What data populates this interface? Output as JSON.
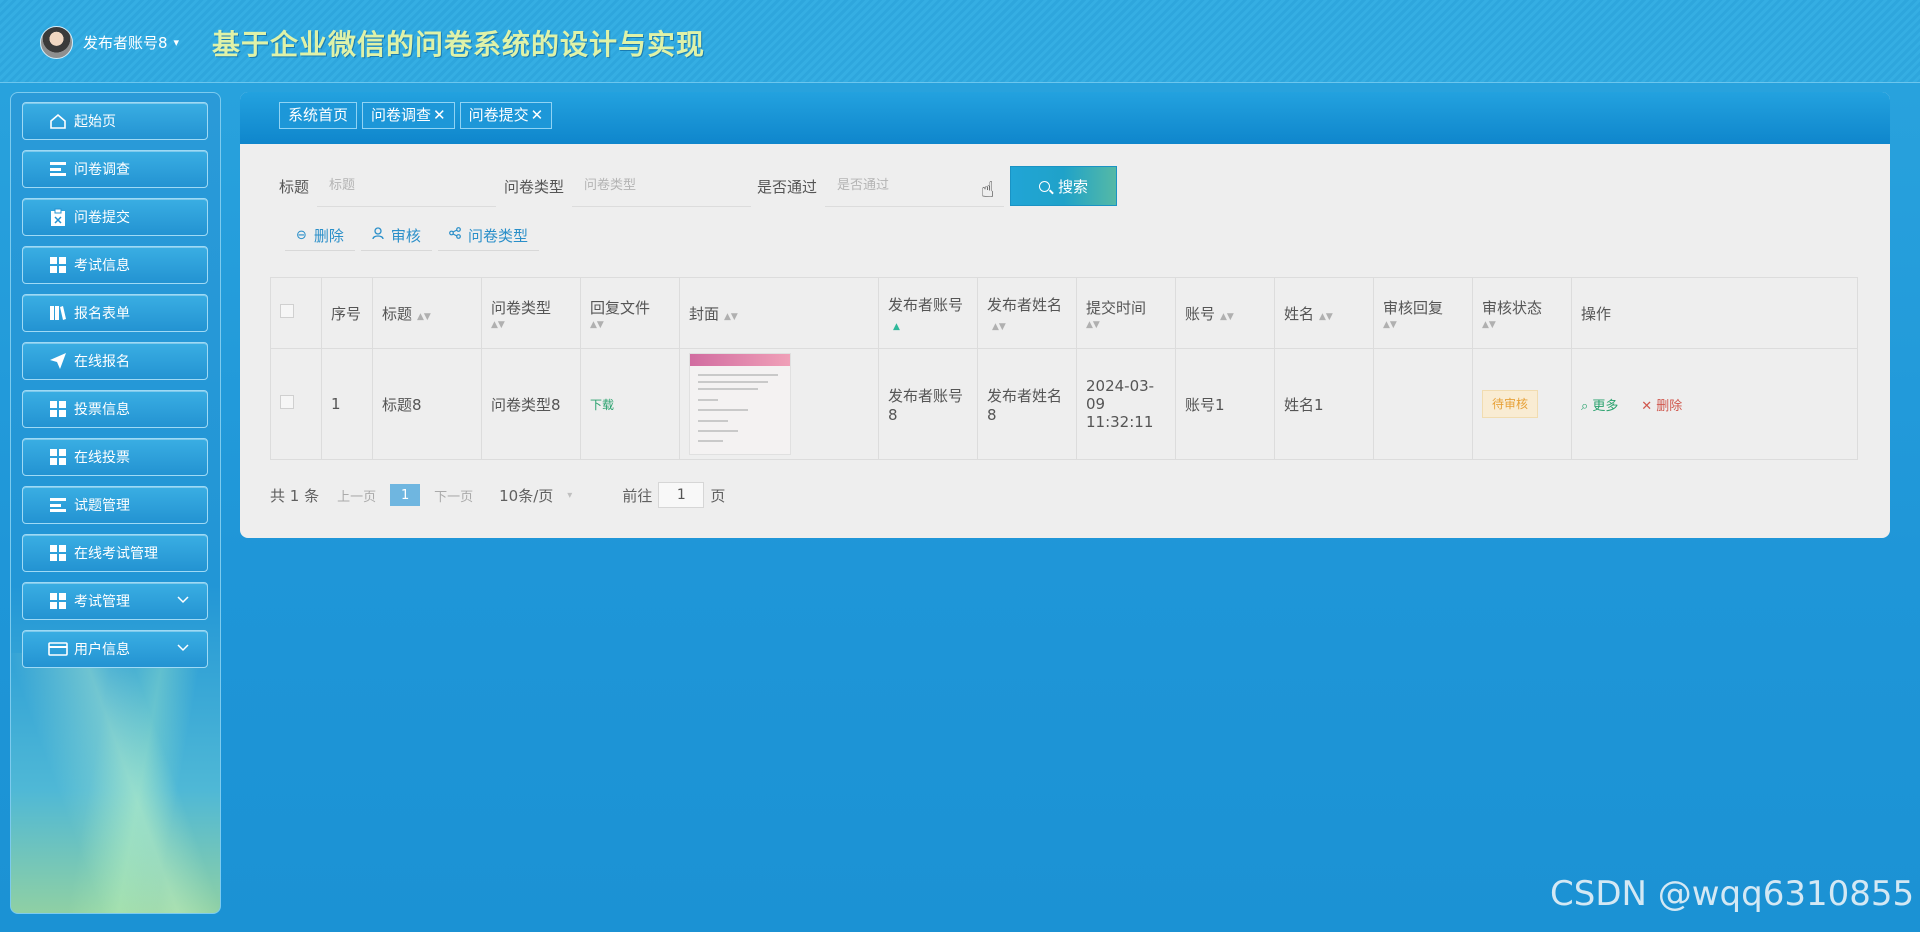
{
  "header": {
    "user_name": "发布者账号8",
    "caret": "▾",
    "app_title": "基于企业微信的问卷系统的设计与实现"
  },
  "sidebar": {
    "items": [
      {
        "label": "起始页",
        "icon": "home-icon"
      },
      {
        "label": "问卷调查",
        "icon": "list-icon"
      },
      {
        "label": "问卷提交",
        "icon": "clipboard-icon"
      },
      {
        "label": "考试信息",
        "icon": "grid-icon"
      },
      {
        "label": "报名表单",
        "icon": "book-icon"
      },
      {
        "label": "在线报名",
        "icon": "send-icon"
      },
      {
        "label": "投票信息",
        "icon": "grid-icon"
      },
      {
        "label": "在线投票",
        "icon": "grid-icon"
      },
      {
        "label": "试题管理",
        "icon": "list-icon"
      },
      {
        "label": "在线考试管理",
        "icon": "grid-icon"
      },
      {
        "label": "考试管理",
        "icon": "grid-icon"
      },
      {
        "label": "用户信息",
        "icon": "card-icon"
      }
    ]
  },
  "tabs": [
    {
      "label": "系统首页",
      "closable": false
    },
    {
      "label": "问卷调查",
      "closable": true
    },
    {
      "label": "问卷提交",
      "closable": true
    }
  ],
  "search": {
    "title_label": "标题",
    "title_placeholder": "标题",
    "type_label": "问卷类型",
    "type_placeholder": "问卷类型",
    "passed_label": "是否通过",
    "passed_placeholder": "是否通过",
    "button_label": "搜索"
  },
  "actions": {
    "delete": "删除",
    "audit": "审核",
    "type": "问卷类型"
  },
  "table": {
    "headers": {
      "index": "序号",
      "title": "标题",
      "type": "问卷类型",
      "reply_file": "回复文件",
      "cover": "封面",
      "publisher_account": "发布者账号",
      "publisher_name": "发布者姓名",
      "submit_time": "提交时间",
      "account": "账号",
      "name": "姓名",
      "audit_reply": "审核回复",
      "audit_status": "审核状态",
      "operation": "操作"
    },
    "rows": [
      {
        "index": "1",
        "title": "标题8",
        "type": "问卷类型8",
        "reply_file": "下载",
        "publisher_account": "发布者账号8",
        "publisher_name": "发布者姓名8",
        "submit_time": "2024-03-09 11:32:11",
        "account": "账号1",
        "name": "姓名1",
        "audit_reply": "",
        "audit_status": "待审核",
        "op_more": "更多",
        "op_delete": "删除"
      }
    ]
  },
  "pager": {
    "total": "共 1 条",
    "prev": "上一页",
    "current": "1",
    "next": "下一页",
    "page_size": "10条/页",
    "goto_prefix": "前往",
    "goto_value": "1",
    "goto_suffix": "页"
  },
  "watermark": "CSDN @wqq6310855",
  "colors": {
    "background": "#1f96d8",
    "title": "#dff2a8",
    "link_green": "#2aa26e",
    "delete_red": "#d0574d",
    "pending_orange": "#e7a23a"
  }
}
